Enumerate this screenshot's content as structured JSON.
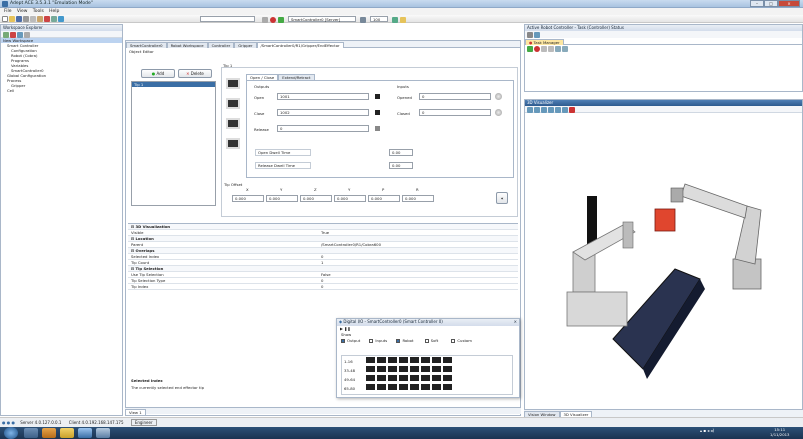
{
  "window": {
    "title": "Adept ACE 3.5.3.1 \"Emulation Mode\"",
    "controls": [
      "–",
      "□",
      "×"
    ]
  },
  "menu": [
    "File",
    "View",
    "Tools",
    "Help"
  ],
  "toolbar": {
    "combo_left": "",
    "combo_right": "SmartController0 [Server]",
    "zoom": "100"
  },
  "workspace_explorer": {
    "title": "Workspace Explorer",
    "items": [
      "New Workspace",
      "Smart Controller",
      "Configuration",
      "Robot (Cobra)",
      "Programs",
      "Variables",
      "SmartController0",
      "Global Configuration",
      "Process",
      "Gripper",
      "Cell"
    ]
  },
  "editor": {
    "tabs": [
      "SmartController0",
      "Robot Workspace",
      "Controller",
      "Gripper",
      "/SmartController0/R1/Gripper/EndEffector"
    ],
    "subheader": "Object Editor",
    "add_label": "Add",
    "delete_label": "Delete",
    "tip_list": [
      "Tip 1"
    ],
    "tip_group": "Tip 1",
    "inner_tabs": [
      "Open / Close",
      "Extend/Retract"
    ],
    "outputs_label": "Outputs",
    "inputs_label": "Inputs",
    "open_label": "Open",
    "close_label": "Close",
    "release_label": "Release",
    "open_value": "1001",
    "close_value": "1002",
    "release_value": "0",
    "open_input_label": "Opened",
    "closed_input_label": "Closed",
    "open_input_value": "0",
    "closed_input_value": "0",
    "open_dwell_label": "Open Dwell Time",
    "close_dwell_label": "Release Dwell Time",
    "open_dwell_value": "0.00",
    "close_dwell_value": "0.00",
    "tip_offset_label": "Tip Offset",
    "offset_headers": [
      "X",
      "Y",
      "Z",
      "Y",
      "P",
      "R"
    ],
    "offset_values": [
      "0.000",
      "0.000",
      "0.000",
      "0.000",
      "0.000",
      "0.000"
    ]
  },
  "properties": {
    "sections": [
      {
        "name": "3D Visualization",
        "rows": [
          [
            "Visible",
            "True"
          ]
        ]
      },
      {
        "name": "Location",
        "rows": [
          [
            "Parent",
            "/SmartController0/R1/Cobra600"
          ]
        ]
      },
      {
        "name": "Overlaps",
        "rows": [
          [
            "Selected Index",
            "0"
          ],
          [
            "Tip Count",
            "1"
          ]
        ]
      },
      {
        "name": "Tip Selection",
        "rows": [
          [
            "Use Tip Selection",
            "False"
          ],
          [
            "Tip Selection Type",
            "0"
          ],
          [
            "Tip Index",
            "0"
          ]
        ]
      }
    ],
    "selected_index_title": "Selected Index",
    "selected_index_desc": "The currently selected end effector tip",
    "status_tab": "View 1"
  },
  "digital_io": {
    "title": "Digital I/O - SmartController0 (Smart Controller 0)",
    "show_label": "Show",
    "filters": [
      {
        "label": "Output",
        "checked": true
      },
      {
        "label": "Inputs",
        "checked": false
      },
      {
        "label": "Robot",
        "checked": true
      },
      {
        "label": "Soft",
        "checked": false
      },
      {
        "label": "Custom",
        "checked": false
      }
    ],
    "rows": [
      "1-16",
      "33-48",
      "49-64",
      "65-80"
    ]
  },
  "task_manager": {
    "title": "Task Manager",
    "header": "Active Robot Controller - Task (Controller) Status"
  },
  "view3d": {
    "title": "3D Visualizer"
  },
  "right_tabs": [
    "Vision Window",
    "3D Visualizer"
  ],
  "statusbar": {
    "server": "Server 4.0.127.0.0.1",
    "client": "Client 4.0.192.168.147.175",
    "engineer": "Engineer"
  },
  "clock": {
    "time": "15:11",
    "date": "1/11/2013"
  },
  "colors": {
    "accent": "#3a6ea5",
    "part": "#e0462e",
    "taskbar": "#1b3351"
  }
}
